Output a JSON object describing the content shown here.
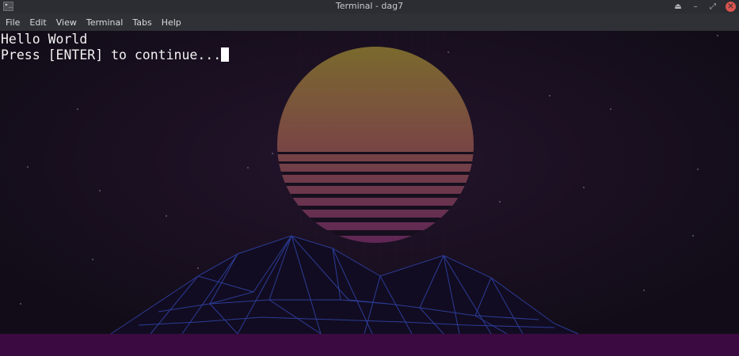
{
  "window": {
    "title": "Terminal - dag7",
    "app_icon_glyph": "▸_",
    "controls": {
      "eject_glyph": "⏏",
      "minimize_glyph": "–",
      "maximize_glyph": "⤢",
      "close_glyph": "✕"
    }
  },
  "menubar": {
    "items": [
      "File",
      "Edit",
      "View",
      "Terminal",
      "Tabs",
      "Help"
    ]
  },
  "terminal": {
    "lines": [
      "Hello World",
      "Press [ENTER] to continue..."
    ]
  },
  "colors": {
    "titlebar": "#2b2d32",
    "menubar": "#2f3136",
    "terminal_bg": "#160f1e",
    "sun_top": "#7d6a2a",
    "sun_bottom": "#6a2b5e",
    "grid": "#2d3f9c",
    "floor": "#3a0a40",
    "close_button": "#d9534f"
  }
}
